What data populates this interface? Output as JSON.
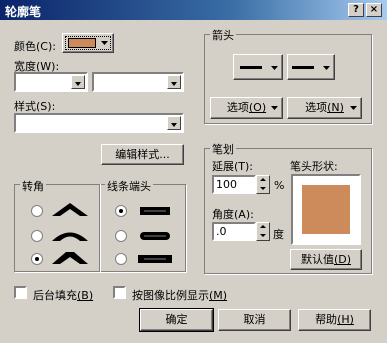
{
  "window": {
    "title": "轮廓笔",
    "help_btn": "?",
    "close_btn": "×"
  },
  "colors": {
    "swatch": "#cd8b5c",
    "titlebar": "#0a246a"
  },
  "color": {
    "label": "颜色",
    "hotkey": "(C):"
  },
  "width": {
    "label": "宽度",
    "hotkey": "(W):",
    "value": "",
    "unit": ""
  },
  "style": {
    "label": "样式",
    "hotkey": "(S):",
    "value": ""
  },
  "edit_style_button": "编辑样式...",
  "corners": {
    "title": "转角",
    "options": [
      {
        "name": "miter",
        "selected": false
      },
      {
        "name": "round",
        "selected": false
      },
      {
        "name": "bevel",
        "selected": true
      }
    ]
  },
  "line_caps": {
    "title": "线条端头",
    "options": [
      {
        "name": "butt",
        "selected": true
      },
      {
        "name": "round",
        "selected": false
      },
      {
        "name": "square",
        "selected": false
      }
    ]
  },
  "arrows": {
    "title": "箭头",
    "options_left": {
      "label": "选项",
      "hotkey": "(O)"
    },
    "options_right": {
      "label": "选项",
      "hotkey": "(N)"
    }
  },
  "nib": {
    "title": "笔划",
    "stretch": {
      "label": "延展",
      "hotkey": "(T):",
      "value": "100",
      "unit": "%"
    },
    "angle": {
      "label": "角度",
      "hotkey": "(A):",
      "value": ".0",
      "unit": "度"
    },
    "shape_label": "笔头形状:",
    "default_button": {
      "label": "默认值",
      "hotkey": "(D)"
    }
  },
  "behind_fill": {
    "label": "后台填充",
    "hotkey": "(B)",
    "checked": false
  },
  "scale_with_image": {
    "label": "按图像比例显示",
    "hotkey": "(M)",
    "checked": false
  },
  "buttons": {
    "ok": "确定",
    "cancel": "取消",
    "help": {
      "label": "帮助",
      "hotkey": "(H)"
    }
  }
}
